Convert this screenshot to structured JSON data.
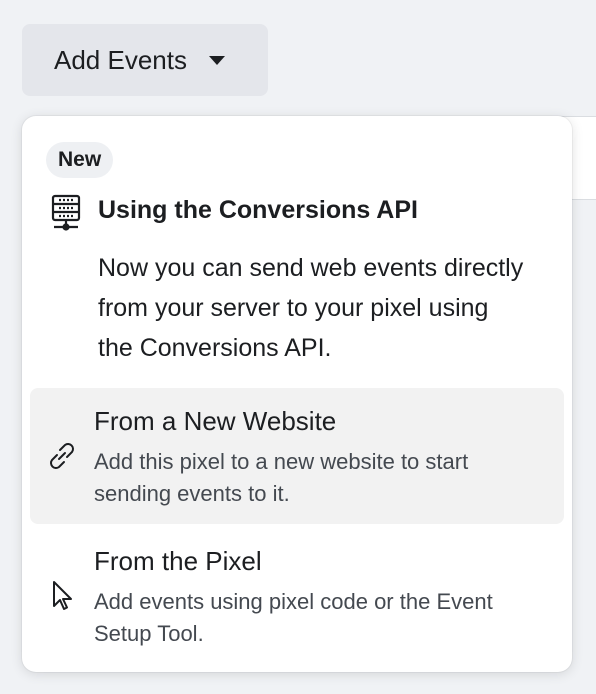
{
  "button": {
    "label": "Add Events",
    "icon": "caret-down-icon"
  },
  "menu": {
    "badge": "New",
    "capi": {
      "icon": "server-icon",
      "title": "Using the Conversions API",
      "description": "Now you can send web events directly from your server to your pixel using the Conversions API."
    },
    "options": [
      {
        "icon": "link-icon",
        "title": "From a New Website",
        "description": "Add this pixel to a new website to start sending events to it.",
        "highlighted": true
      },
      {
        "icon": "cursor-icon",
        "title": "From the Pixel",
        "description": "Add events using pixel code or the Event Setup Tool.",
        "highlighted": false
      }
    ]
  },
  "colors": {
    "button_bg": "#e4e6eb",
    "menu_bg": "#ffffff",
    "hover_bg": "#f2f2f2",
    "text_primary": "#1c1e21",
    "text_secondary": "#444950"
  }
}
